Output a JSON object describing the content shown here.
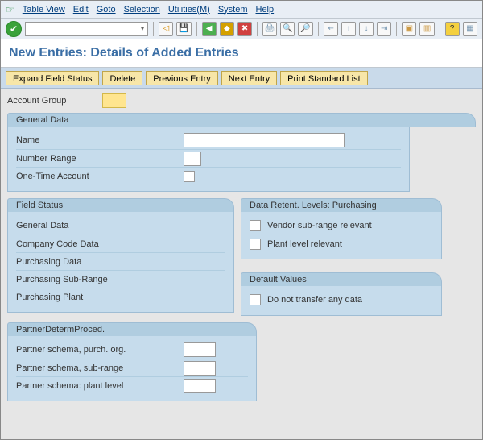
{
  "menu": {
    "items": [
      "Table View",
      "Edit",
      "Goto",
      "Selection",
      "Utilities(M)",
      "System",
      "Help"
    ]
  },
  "title": "New Entries: Details of Added Entries",
  "actions": {
    "expand": "Expand Field Status",
    "delete": "Delete",
    "previous": "Previous Entry",
    "next": "Next Entry",
    "print": "Print Standard List"
  },
  "account_group": {
    "label": "Account Group",
    "value": ""
  },
  "general_data": {
    "title": "General Data",
    "name_label": "Name",
    "name_value": "",
    "number_range_label": "Number Range",
    "number_range_value": "",
    "one_time_label": "One-Time Account",
    "one_time_checked": false
  },
  "field_status": {
    "title": "Field Status",
    "items": [
      "General Data",
      "Company Code Data",
      "Purchasing Data",
      "Purchasing Sub-Range",
      "Purchasing Plant"
    ]
  },
  "data_retent": {
    "title": "Data Retent. Levels: Purchasing",
    "vendor_label": "Vendor sub-range relevant",
    "vendor_checked": false,
    "plant_label": "Plant level relevant",
    "plant_checked": false
  },
  "default_values": {
    "title": "Default Values",
    "no_transfer_label": "Do not transfer any data",
    "no_transfer_checked": false
  },
  "partner": {
    "title": "PartnerDetermProced.",
    "purch_org_label": "Partner schema, purch. org.",
    "purch_org_value": "",
    "sub_range_label": "Partner schema, sub-range",
    "sub_range_value": "",
    "plant_level_label": "Partner schema: plant level",
    "plant_level_value": ""
  }
}
